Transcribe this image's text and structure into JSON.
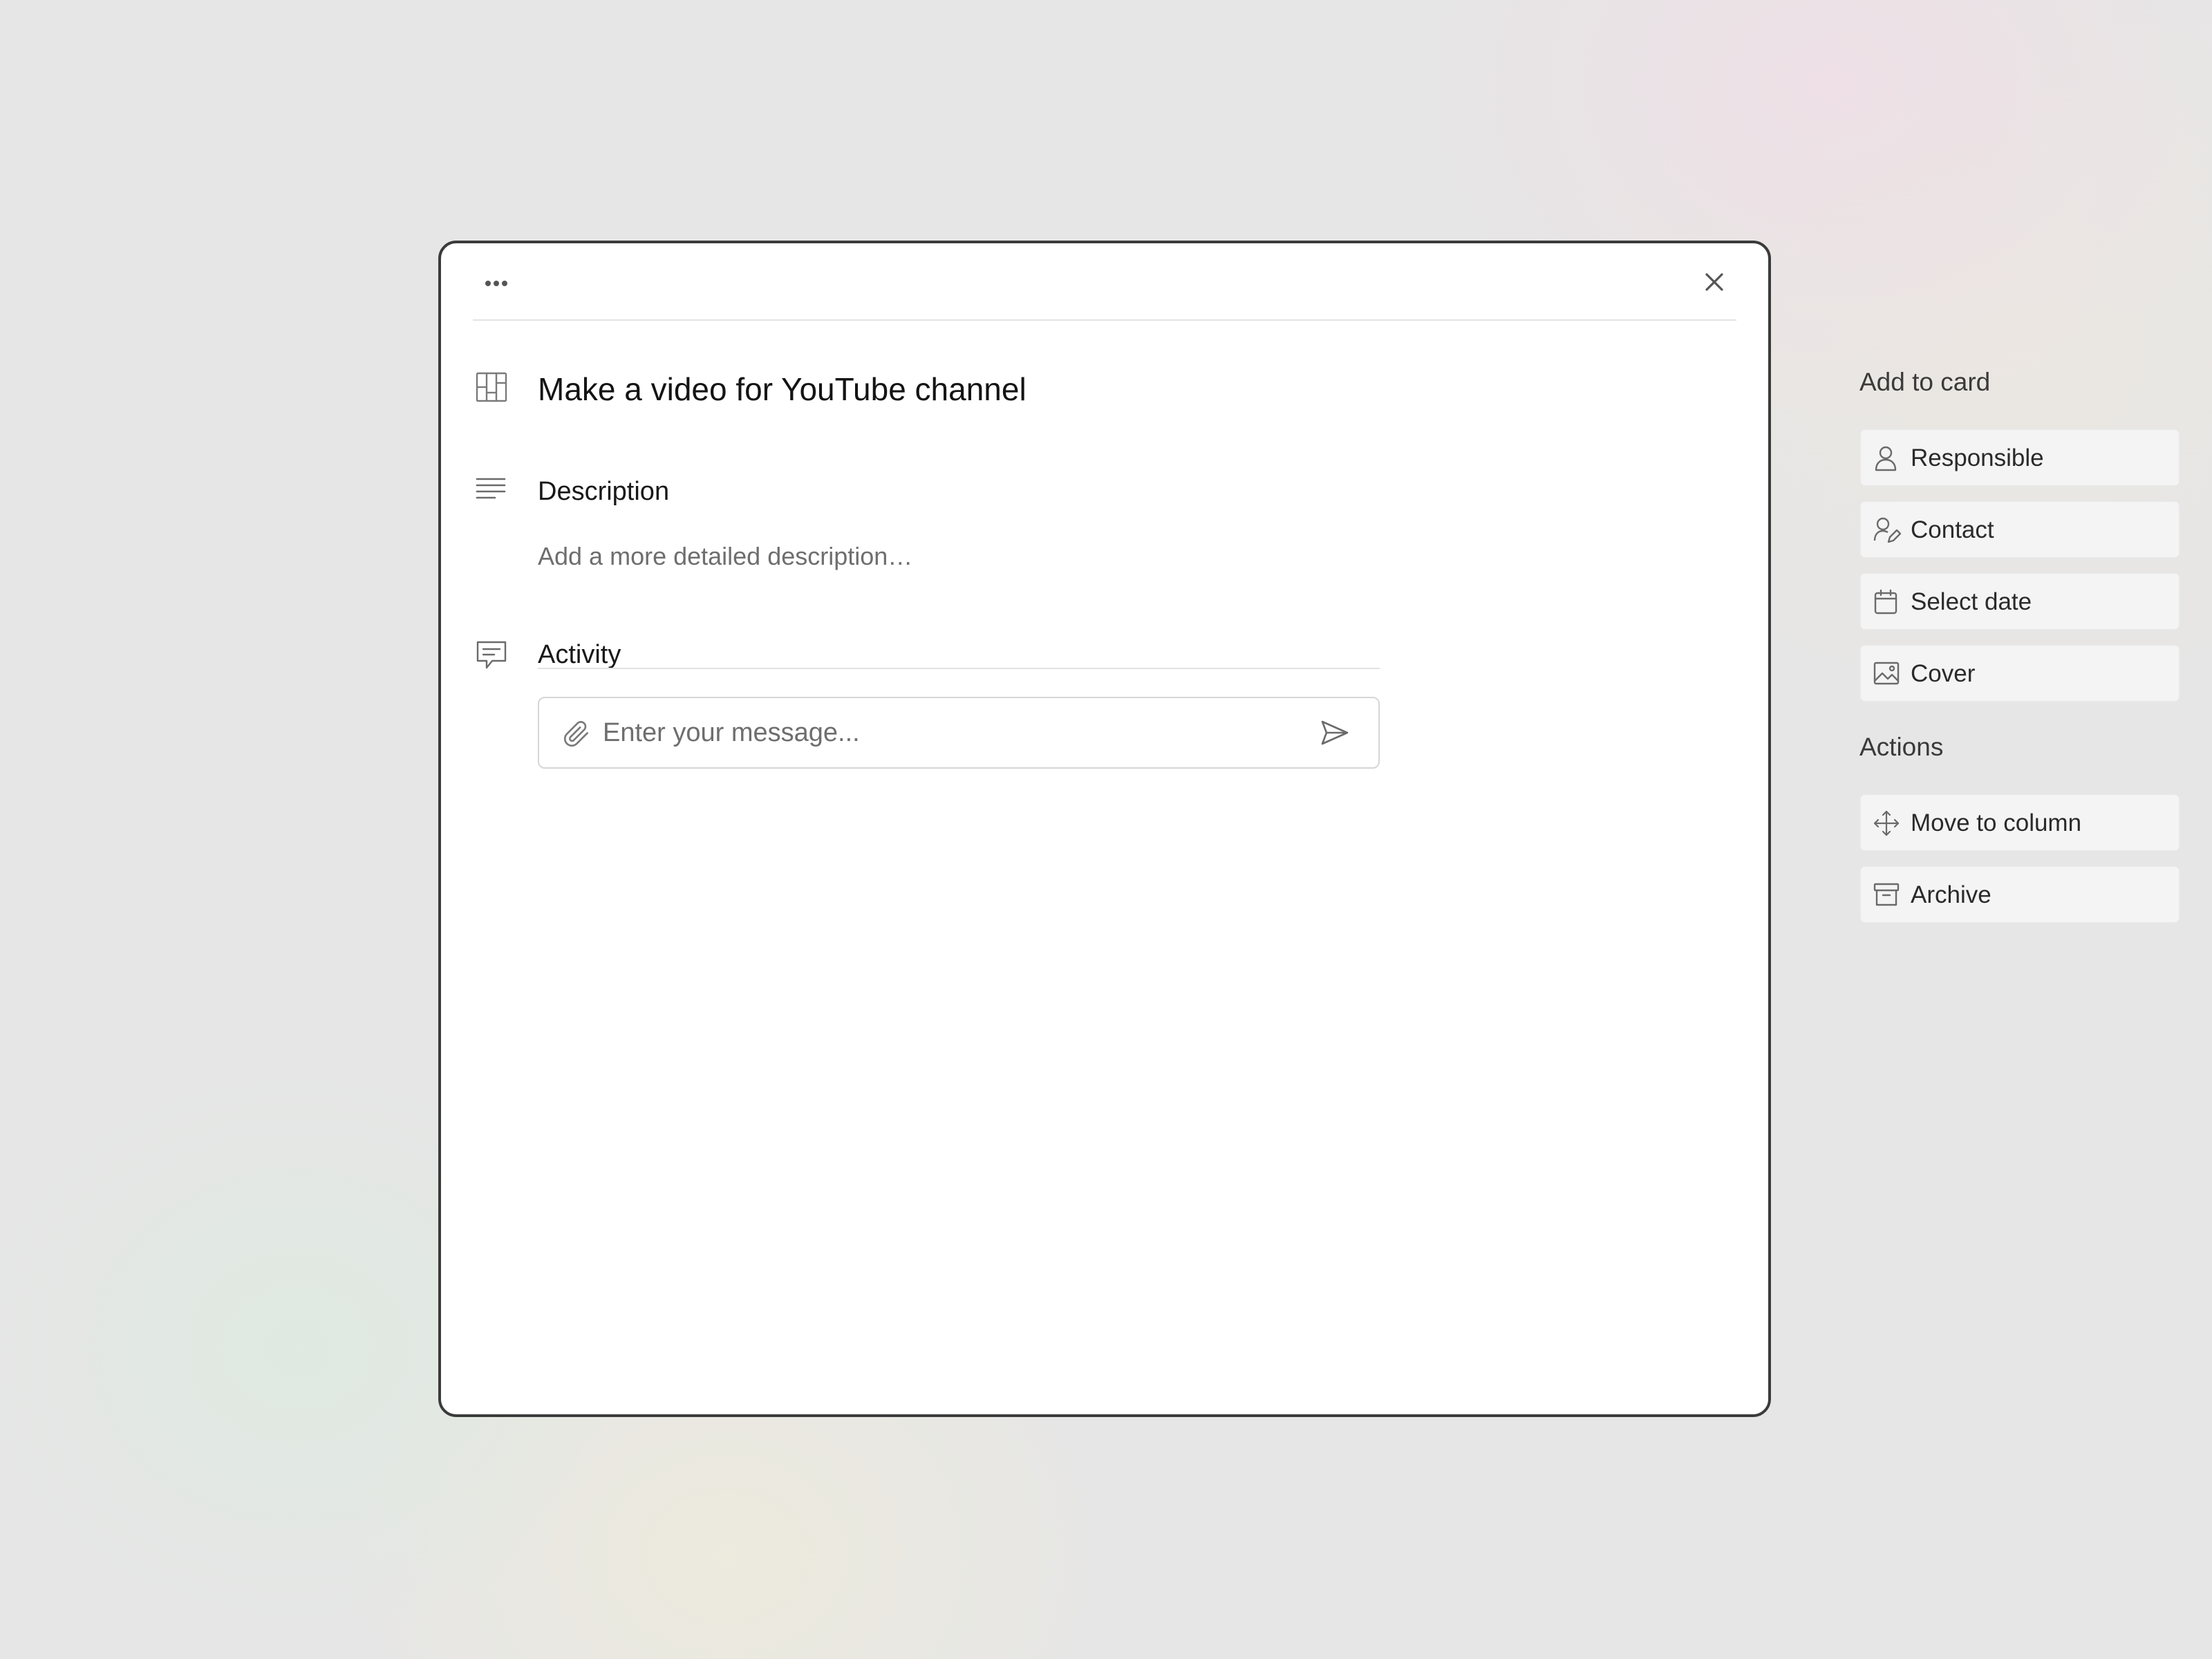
{
  "card": {
    "title": "Make a video for YouTube channel"
  },
  "header": {
    "menu_icon": "more-dots-icon",
    "close_icon": "close-icon"
  },
  "description": {
    "heading": "Description",
    "placeholder": "Add a more detailed description…",
    "icon": "text-lines-icon"
  },
  "activity": {
    "heading": "Activity",
    "icon": "comment-icon",
    "message_placeholder": "Enter your message...",
    "message_value": "",
    "attach_icon": "paperclip-icon",
    "send_icon": "send-icon"
  },
  "sidebar": {
    "add_heading": "Add to card",
    "add_items": [
      {
        "label": "Responsible",
        "icon": "user-icon"
      },
      {
        "label": "Contact",
        "icon": "user-edit-icon"
      },
      {
        "label": "Select date",
        "icon": "calendar-icon"
      },
      {
        "label": "Cover",
        "icon": "image-icon"
      }
    ],
    "actions_heading": "Actions",
    "action_items": [
      {
        "label": "Move to column",
        "icon": "move-arrows-icon"
      },
      {
        "label": "Archive",
        "icon": "archive-box-icon"
      }
    ]
  },
  "colors": {
    "modal_border": "#3b3b3b",
    "button_bg": "#f4f4f4",
    "divider": "#e3e3e3",
    "placeholder_text": "#6e6e6e",
    "icon_gray": "#7a7a7a"
  }
}
